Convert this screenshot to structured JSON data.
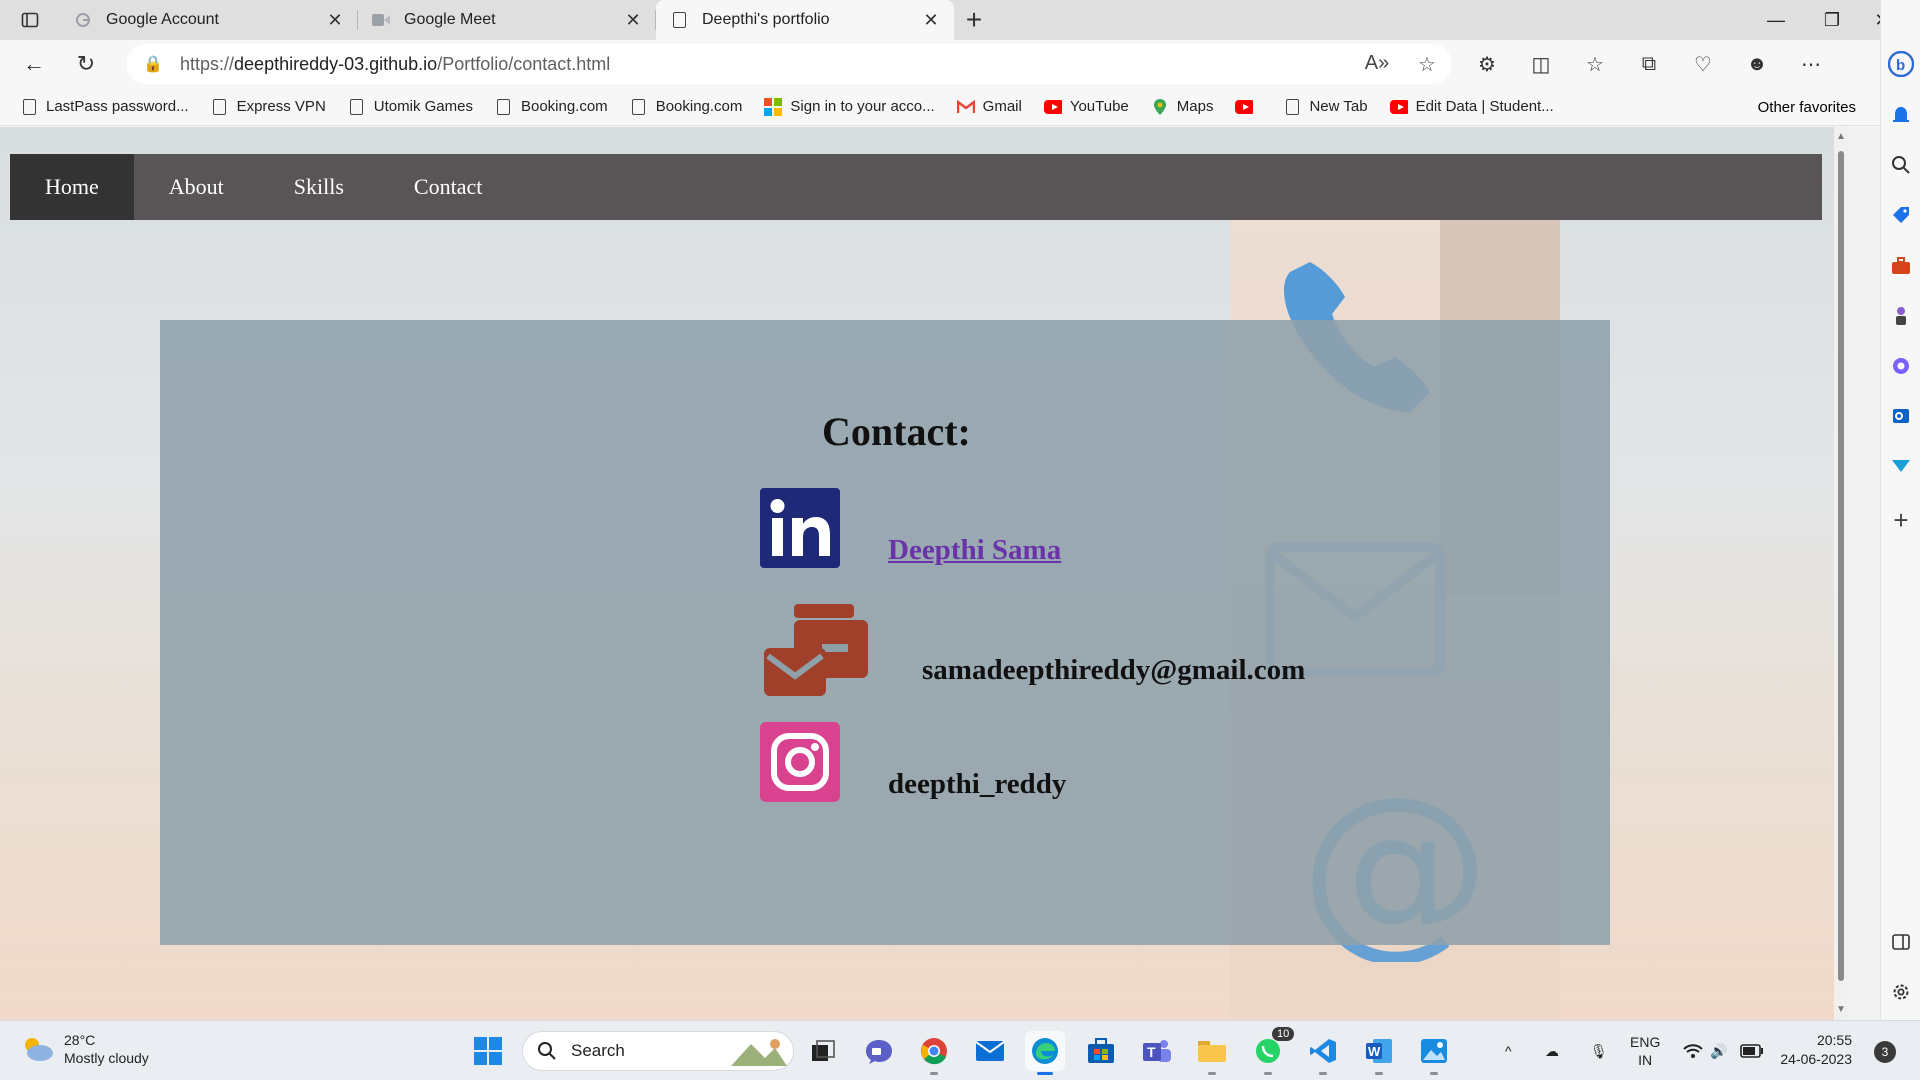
{
  "browser": {
    "tabs": [
      {
        "title": "Google Account",
        "favicon": "google-icon"
      },
      {
        "title": "Google Meet",
        "favicon": "meet-icon"
      },
      {
        "title": "Deepthi's portfolio",
        "favicon": "page-icon"
      }
    ],
    "url": {
      "prefix": "https://",
      "host": "deepthireddy-03.github.io",
      "path": "/Portfolio/contact.html"
    },
    "bookmarks": [
      {
        "label": "LastPass password...",
        "icon": "page-icon"
      },
      {
        "label": "Express VPN",
        "icon": "page-icon"
      },
      {
        "label": "Utomik Games",
        "icon": "page-icon"
      },
      {
        "label": "Booking.com",
        "icon": "page-icon"
      },
      {
        "label": "Booking.com",
        "icon": "page-icon"
      },
      {
        "label": "Sign in to your acco...",
        "icon": "microsoft-icon"
      },
      {
        "label": "Gmail",
        "icon": "gmail-icon"
      },
      {
        "label": "YouTube",
        "icon": "youtube-icon"
      },
      {
        "label": "Maps",
        "icon": "maps-icon"
      },
      {
        "label": "",
        "icon": "youtube-icon"
      },
      {
        "label": "New Tab",
        "icon": "page-icon"
      },
      {
        "label": "Edit Data | Student...",
        "icon": "youtube-icon"
      }
    ],
    "other_favorites": "Other favorites"
  },
  "page": {
    "nav": [
      "Home",
      "About",
      "Skills",
      "Contact"
    ],
    "contact_title": "Contact:",
    "linkedin_name": " Deepthi Sama",
    "email": "samadeepthireddy@gmail.com",
    "instagram": "deepthi_reddy"
  },
  "taskbar": {
    "weather_temp": "28°C",
    "weather_desc": "Mostly cloudy",
    "search_placeholder": "Search",
    "whatsapp_badge": "10",
    "lang_top": "ENG",
    "lang_bottom": "IN",
    "time": "20:55",
    "date": "24-06-2023",
    "notifications": "3"
  },
  "colors": {
    "nav_bg": "#595556",
    "nav_active": "#333333",
    "contact_box": "#8fa0aa",
    "linkedin": "#1e2a78",
    "mail": "#a0402a",
    "instagram": "#d9428e",
    "link": "#6a33a8"
  }
}
